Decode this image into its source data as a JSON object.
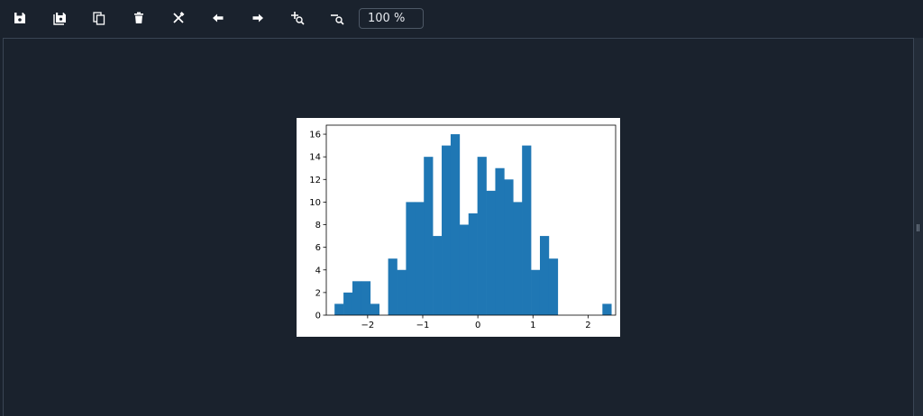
{
  "toolbar": {
    "buttons": [
      {
        "name": "save-button",
        "icon": "floppy-disk-icon"
      },
      {
        "name": "save-all-button",
        "icon": "floppy-stack-icon"
      },
      {
        "name": "copy-button",
        "icon": "copy-icon"
      },
      {
        "name": "delete-button",
        "icon": "trash-icon"
      },
      {
        "name": "delete-all-button",
        "icon": "cross-icon"
      },
      {
        "name": "previous-button",
        "icon": "arrow-left-icon"
      },
      {
        "name": "next-button",
        "icon": "arrow-right-icon"
      },
      {
        "name": "zoom-in-button",
        "icon": "zoom-in-icon"
      },
      {
        "name": "zoom-out-button",
        "icon": "zoom-out-icon"
      }
    ],
    "zoom_value": "100 %"
  },
  "colors": {
    "background": "#1a222d",
    "icon": "#ffffff",
    "bar": "#1f77b4",
    "figure": "#ffffff"
  },
  "chart_data": {
    "type": "bar",
    "title": "",
    "xlabel": "",
    "ylabel": "",
    "xlim": [
      -2.75,
      2.5
    ],
    "ylim": [
      0,
      16.8
    ],
    "bin_start": -2.6,
    "bin_width": 0.162,
    "counts": [
      1,
      2,
      3,
      3,
      1,
      0,
      5,
      4,
      10,
      10,
      14,
      7,
      15,
      16,
      8,
      9,
      14,
      11,
      13,
      12,
      10,
      15,
      4,
      7,
      5,
      0,
      0,
      0,
      0,
      0,
      1
    ],
    "x_ticks": [
      -2,
      -1,
      0,
      1,
      2
    ],
    "x_tick_labels": [
      "−2",
      "−1",
      "0",
      "1",
      "2"
    ],
    "y_ticks": [
      0,
      2,
      4,
      6,
      8,
      10,
      12,
      14,
      16
    ],
    "y_tick_labels": [
      "0",
      "2",
      "4",
      "6",
      "8",
      "10",
      "12",
      "14",
      "16"
    ],
    "grid": false,
    "legend": "none"
  }
}
